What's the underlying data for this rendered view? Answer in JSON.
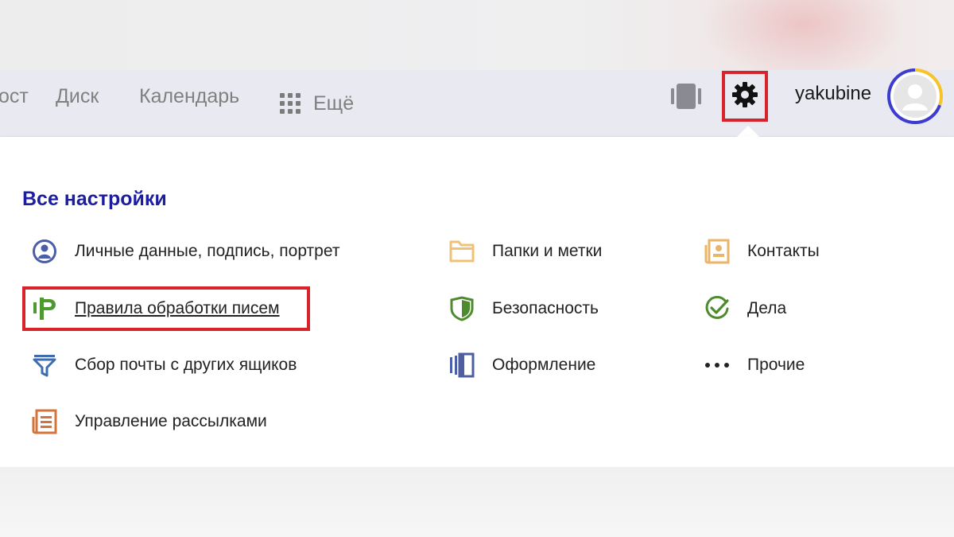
{
  "header": {
    "nav": {
      "partial": "ост",
      "disk": "Диск",
      "calendar": "Календарь",
      "more": "Ещё"
    },
    "icons": {
      "more": "grid-icon",
      "device": "phone-icon",
      "settings": "gear-icon"
    },
    "username": "yakubine"
  },
  "settings_panel": {
    "title": "Все настройки",
    "columns": [
      [
        {
          "label": "Личные данные, подпись, портрет",
          "icon": "person-icon",
          "color": "#4c5da8"
        },
        {
          "label": "Правила обработки писем",
          "icon": "rules-icon",
          "color": "#4e9a2f"
        },
        {
          "label": "Сбор почты с других ящиков",
          "icon": "funnel-icon",
          "color": "#3f6bb0"
        },
        {
          "label": "Управление рассылками",
          "icon": "newsletter-icon",
          "color": "#d2743c"
        }
      ],
      [
        {
          "label": "Папки и метки",
          "icon": "folder-icon",
          "color": "#f0c176"
        },
        {
          "label": "Безопасность",
          "icon": "shield-icon",
          "color": "#4e8b2e"
        },
        {
          "label": "Оформление",
          "icon": "theme-icon",
          "color": "#4d5ea3"
        }
      ],
      [
        {
          "label": "Контакты",
          "icon": "contacts-icon",
          "color": "#e9b669"
        },
        {
          "label": "Дела",
          "icon": "check-icon",
          "color": "#4e8b2e"
        },
        {
          "label": "Прочие",
          "icon": "dots-icon",
          "color": "#222222"
        }
      ]
    ]
  },
  "colors": {
    "highlight": "#d8232a",
    "title": "#1d1d9f",
    "header_bg": "#e9eaf1"
  }
}
